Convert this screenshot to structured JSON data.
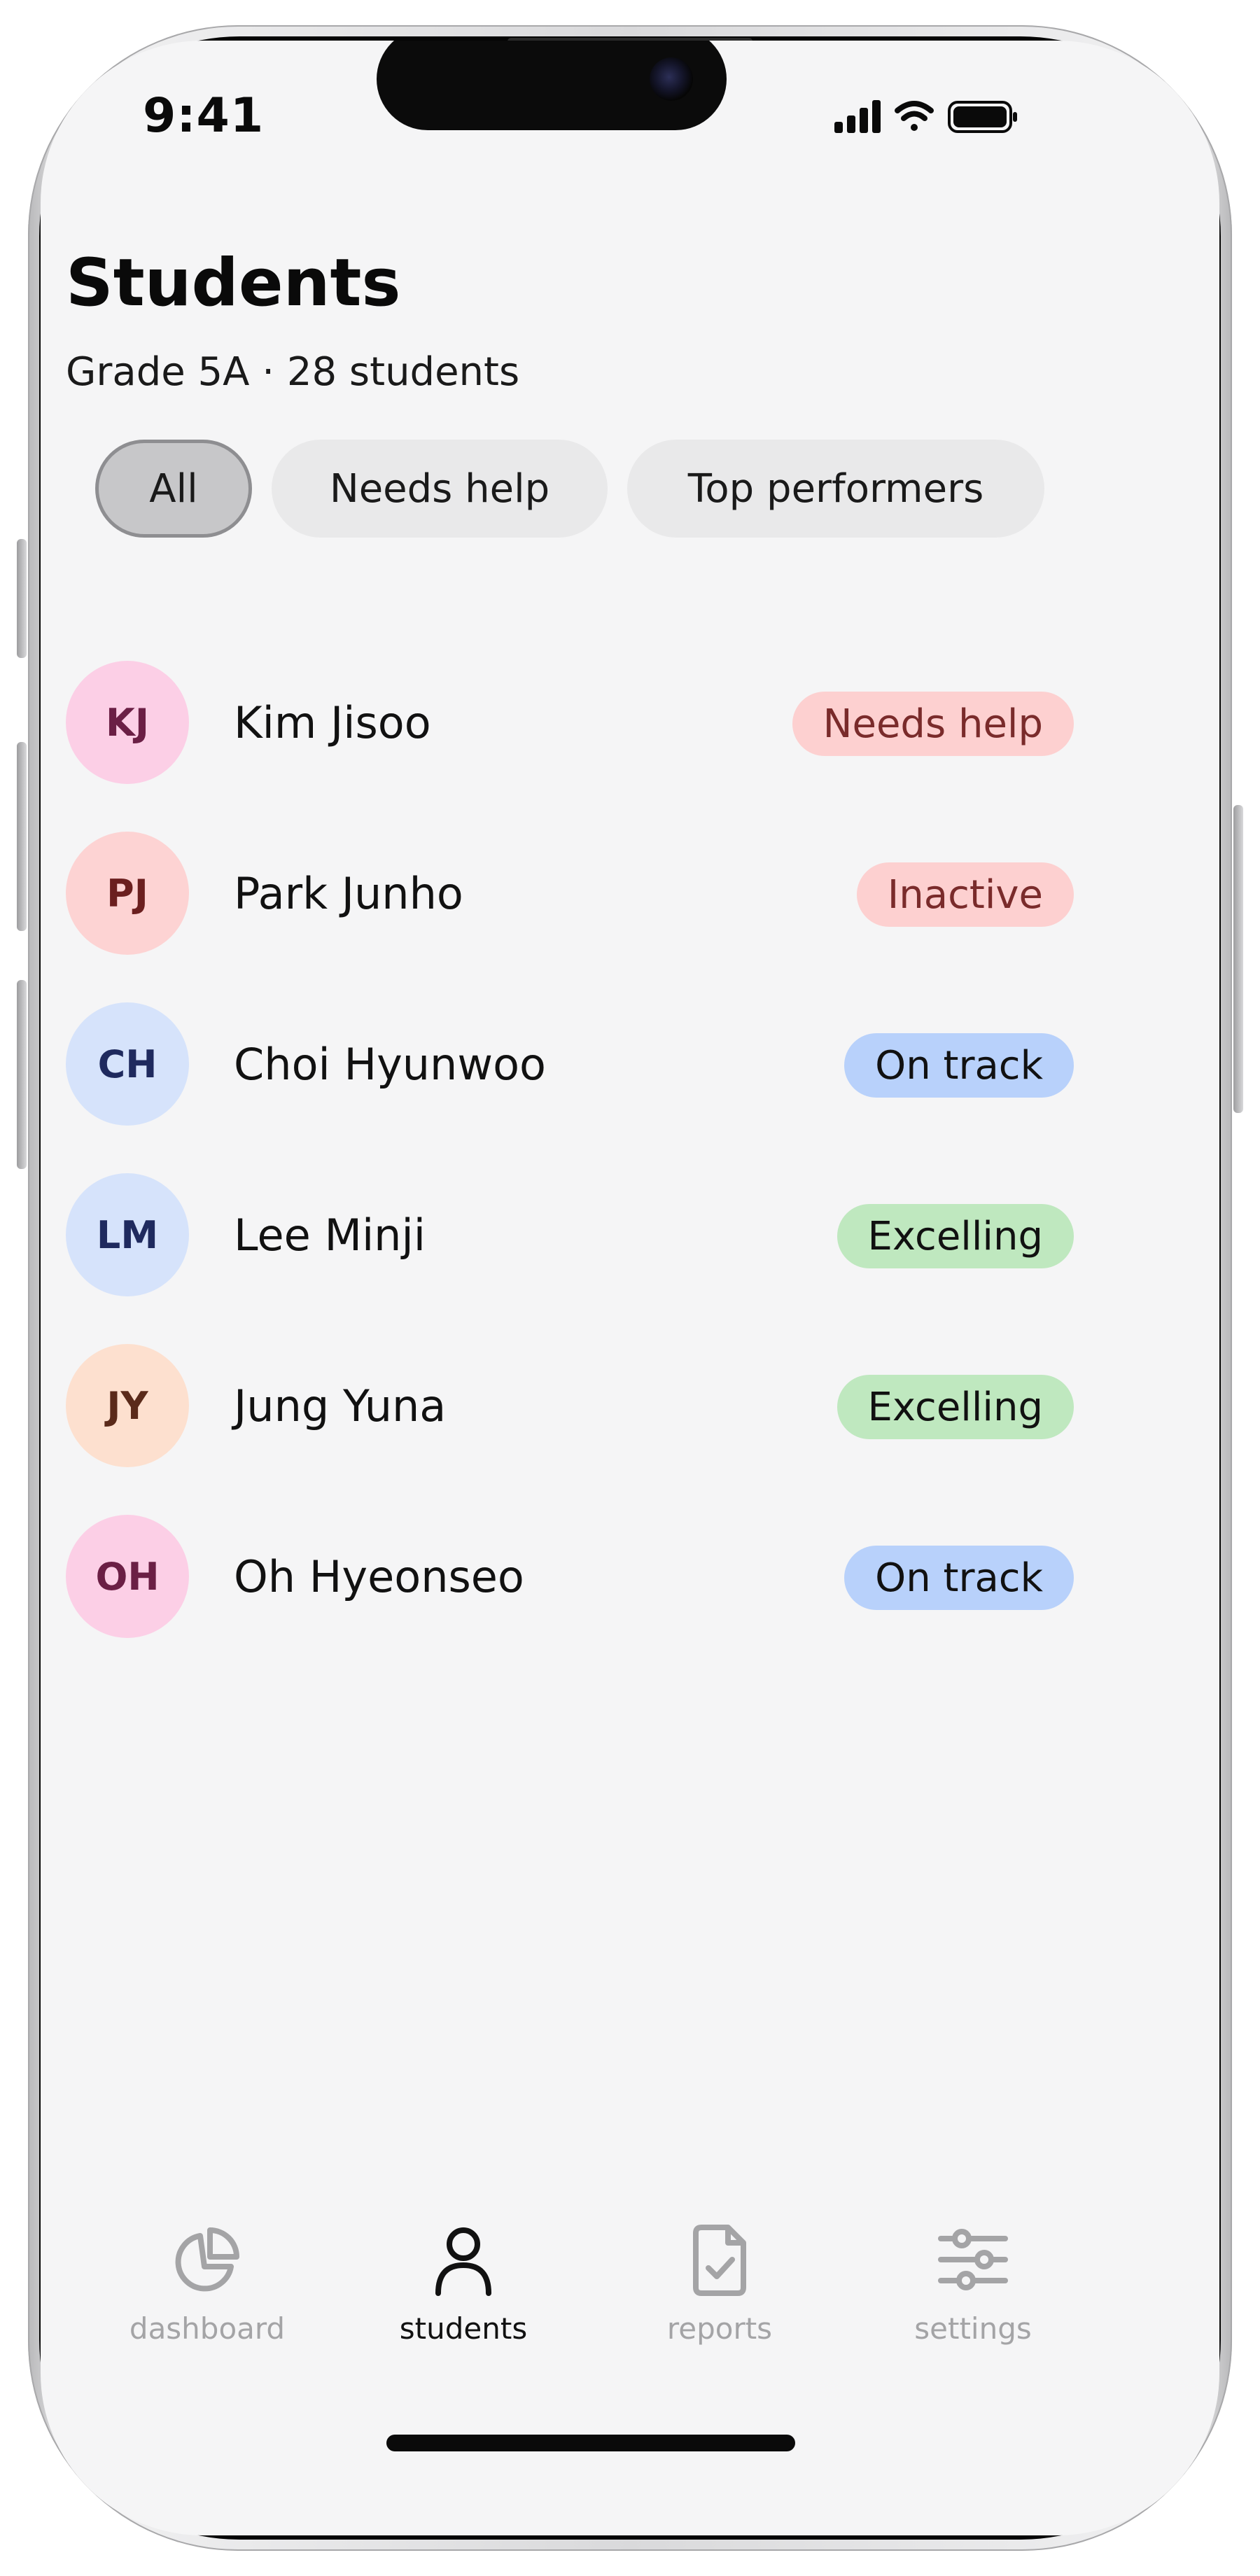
{
  "status_bar": {
    "time": "9:41"
  },
  "header": {
    "title": "Students",
    "subtitle": "Grade 5A · 28 students"
  },
  "filters": [
    {
      "label": "All",
      "selected": true
    },
    {
      "label": "Needs help",
      "selected": false
    },
    {
      "label": "Top performers",
      "selected": false
    }
  ],
  "students": [
    {
      "initials": "KJ",
      "name": "Kim Jisoo",
      "status": "Needs help",
      "avatar_bg": "#fccfe6",
      "avatar_fg": "#6b1f45",
      "badge_bg": "#fdd0d0",
      "badge_fg": "#7a2b2b"
    },
    {
      "initials": "PJ",
      "name": "Park Junho",
      "status": "Inactive",
      "avatar_bg": "#fdd3d3",
      "avatar_fg": "#6b1f1f",
      "badge_bg": "#fdd0d0",
      "badge_fg": "#7a2b2b"
    },
    {
      "initials": "CH",
      "name": "Choi Hyunwoo",
      "status": "On track",
      "avatar_bg": "#d6e3fb",
      "avatar_fg": "#1f2a5e",
      "badge_bg": "#b8d1fb",
      "badge_fg": "#111111"
    },
    {
      "initials": "LM",
      "name": "Lee Minji",
      "status": "Excelling",
      "avatar_bg": "#d6e3fb",
      "avatar_fg": "#1f2a5e",
      "badge_bg": "#bfe8bf",
      "badge_fg": "#111111"
    },
    {
      "initials": "JY",
      "name": "Jung Yuna",
      "status": "Excelling",
      "avatar_bg": "#fde0cf",
      "avatar_fg": "#5a2a1a",
      "badge_bg": "#bfe8bf",
      "badge_fg": "#111111"
    },
    {
      "initials": "OH",
      "name": "Oh Hyeonseo",
      "status": "On track",
      "avatar_bg": "#fccfe6",
      "avatar_fg": "#6b1f45",
      "badge_bg": "#b8d1fb",
      "badge_fg": "#111111"
    }
  ],
  "tabbar": [
    {
      "label": "dashboard",
      "icon": "pie-chart-icon",
      "active": false
    },
    {
      "label": "students",
      "icon": "person-icon",
      "active": true
    },
    {
      "label": "reports",
      "icon": "report-check-icon",
      "active": false
    },
    {
      "label": "settings",
      "icon": "sliders-icon",
      "active": false
    }
  ]
}
